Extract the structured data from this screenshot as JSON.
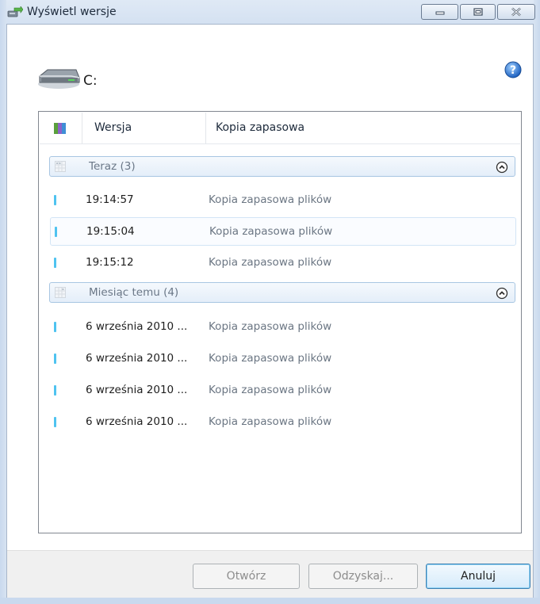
{
  "window": {
    "title": "Wyświetl wersje"
  },
  "drive": {
    "label": "C:"
  },
  "list": {
    "columns": [
      "Wersja",
      "Kopia zapasowa"
    ],
    "groups": [
      {
        "label": "Teraz (3)"
      },
      {
        "label": "Miesiąc temu (4)"
      }
    ],
    "rows": [
      {
        "version": "19:14:57",
        "backup": "Kopia zapasowa plików"
      },
      {
        "version": "19:15:04",
        "backup": "Kopia zapasowa plików"
      },
      {
        "version": "19:15:12",
        "backup": "Kopia zapasowa plików"
      },
      {
        "version": "6 września 2010 ...",
        "backup": "Kopia zapasowa plików"
      },
      {
        "version": "6 września 2010 ...",
        "backup": "Kopia zapasowa plików"
      },
      {
        "version": "6 września 2010 ...",
        "backup": "Kopia zapasowa plików"
      },
      {
        "version": "6 września 2010 ...",
        "backup": "Kopia zapasowa plików"
      }
    ]
  },
  "buttons": {
    "open": "Otwórz",
    "recover": "Odzyskaj...",
    "cancel": "Anuluj"
  },
  "colors": {
    "accent": "#4fc3f0",
    "frame": "#c9d9ee",
    "group_border": "#a8c6e2"
  }
}
